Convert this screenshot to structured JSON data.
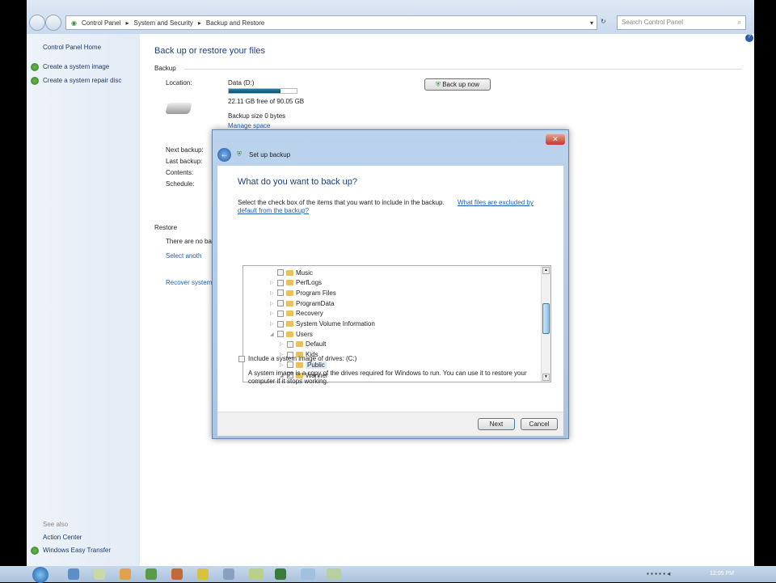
{
  "address": {
    "crumbs": [
      "Control Panel",
      "System and Security",
      "Backup and Restore"
    ],
    "search_placeholder": "Search Control Panel"
  },
  "sidebar": {
    "home": "Control Panel Home",
    "items": [
      "Create a system image",
      "Create a system repair disc"
    ],
    "see_also": "See also",
    "see_also_items": [
      "Action Center",
      "Windows Easy Transfer"
    ]
  },
  "main": {
    "title": "Back up or restore your files",
    "backup_section": "Backup",
    "location_label": "Location:",
    "location_value": "Data (D:)",
    "drive_used_fraction": 0.76,
    "free_text": "22.11 GB free of 90.05 GB",
    "backup_size": "Backup size 0 bytes",
    "manage_space": "Manage space",
    "backup_now": "Back up now",
    "labels": [
      "Next backup:",
      "Last backup:",
      "Contents:",
      "Schedule:"
    ],
    "restore_section": "Restore",
    "restore_text": "There are no ba",
    "select_another": "Select anoth",
    "recover_system": "Recover system"
  },
  "dialog": {
    "title": "Set up backup",
    "heading": "What do you want to back up?",
    "instruction": "Select the check box of the items that you want to include in the backup.",
    "help_link_1": "What files are excluded by",
    "help_link_2": "default from the backup?",
    "tree": [
      {
        "name": "Music",
        "level": 0,
        "arrow": ""
      },
      {
        "name": "PerfLogs",
        "level": 0,
        "arrow": "▷"
      },
      {
        "name": "Program Files",
        "level": 0,
        "arrow": "▷"
      },
      {
        "name": "ProgramData",
        "level": 0,
        "arrow": "▷"
      },
      {
        "name": "Recovery",
        "level": 0,
        "arrow": "▷"
      },
      {
        "name": "System Volume Information",
        "level": 0,
        "arrow": "▷"
      },
      {
        "name": "Users",
        "level": 0,
        "arrow": "◢"
      },
      {
        "name": "Default",
        "level": 1,
        "arrow": "▷"
      },
      {
        "name": "Kids",
        "level": 1,
        "arrow": "▷"
      },
      {
        "name": "Public",
        "level": 1,
        "arrow": "▷"
      },
      {
        "name": "Wanner",
        "level": 1,
        "arrow": "◢"
      }
    ],
    "include_image": "Include a system image of drives: (C:)",
    "image_note_1": "A system image is a copy of the drives required for Windows to run. You can use it to restore your",
    "image_note_2": "computer if it stops working.",
    "next": "Next",
    "cancel": "Cancel"
  },
  "taskbar": {
    "clock": "12:05 PM"
  }
}
